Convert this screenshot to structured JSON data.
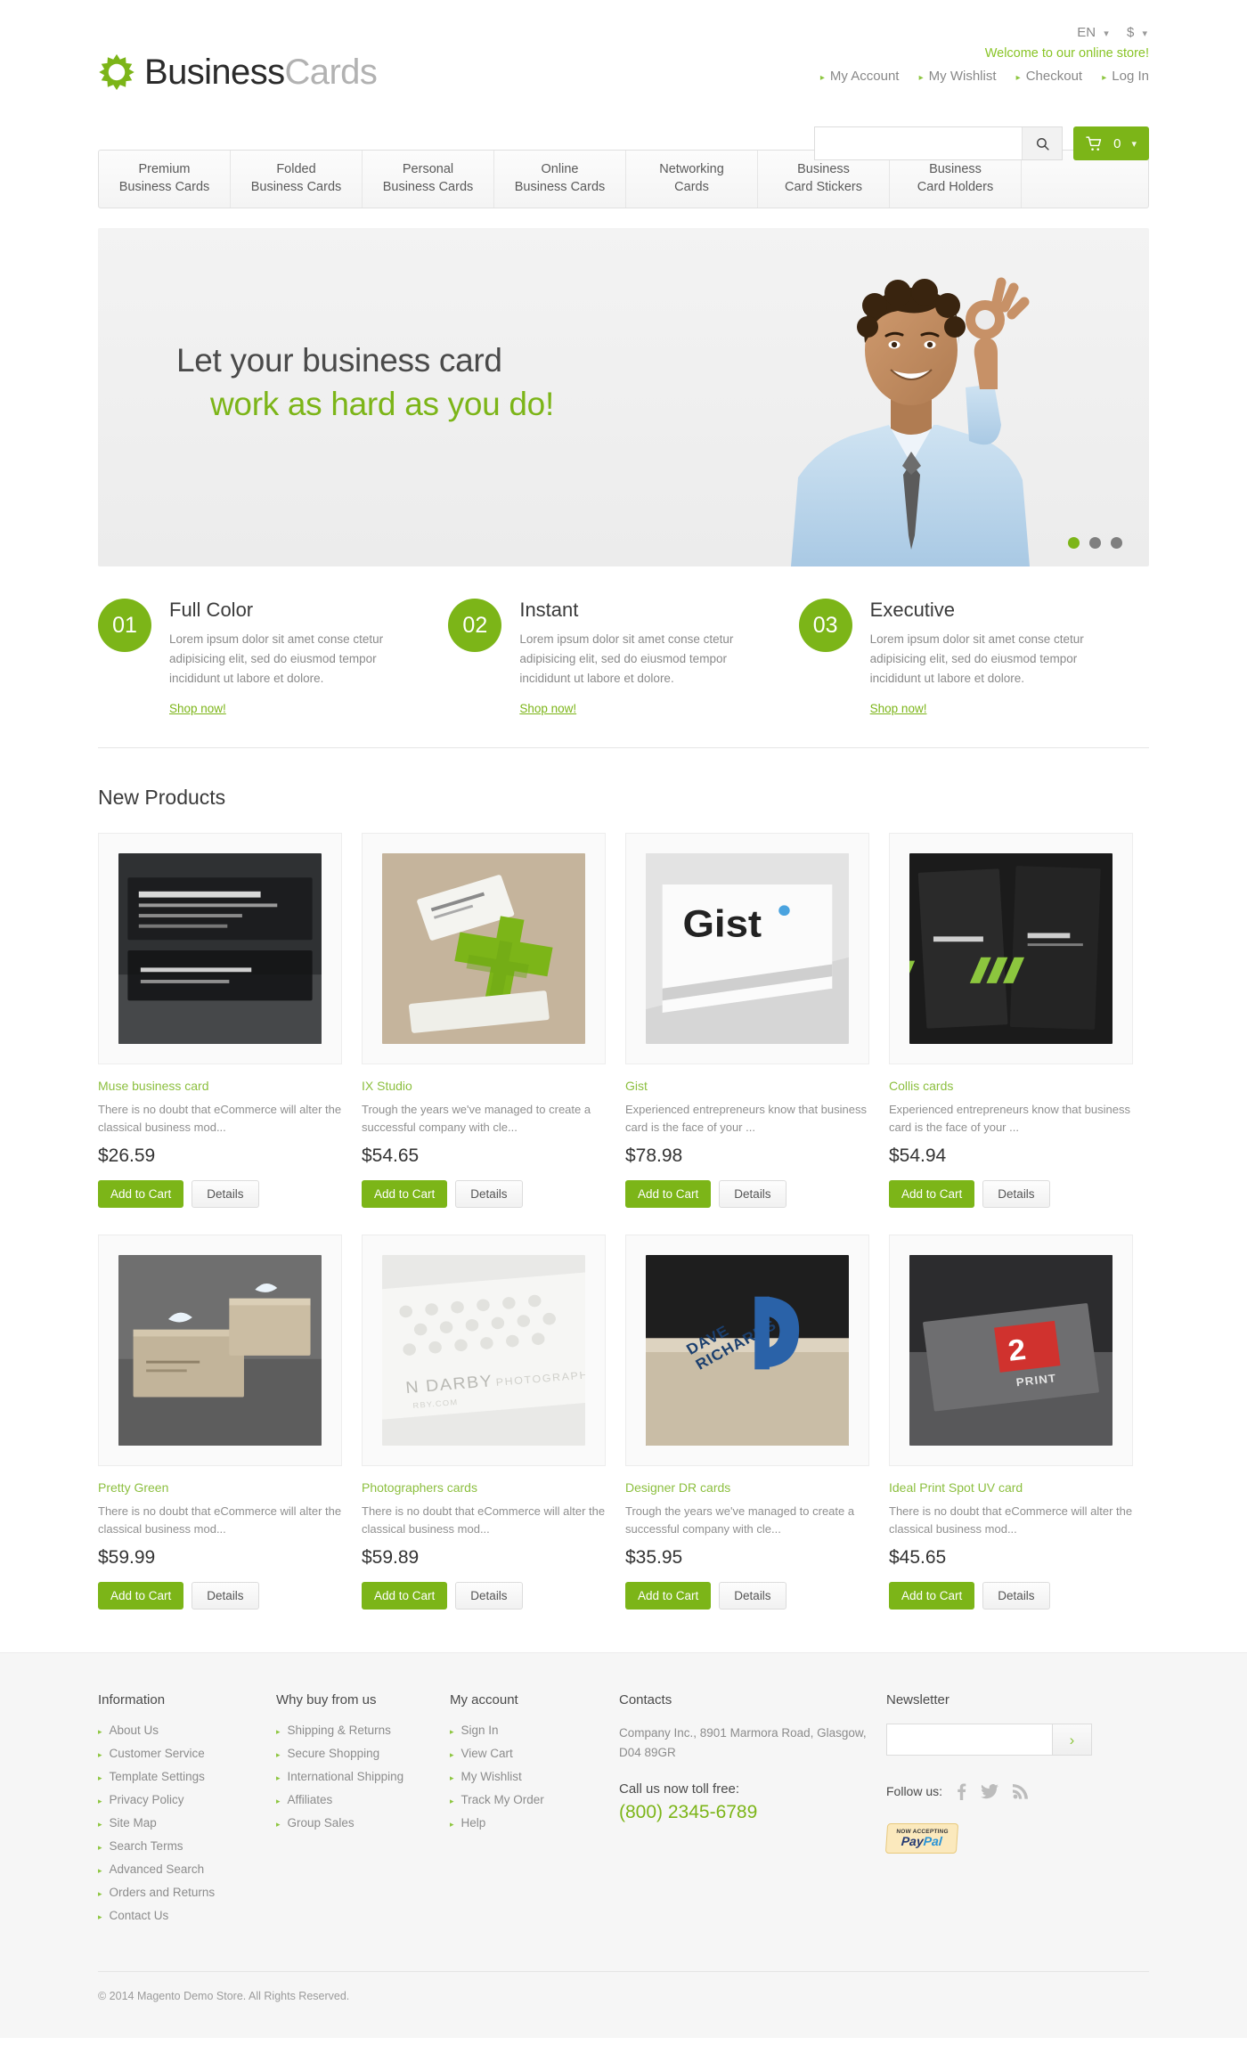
{
  "header": {
    "language": "EN",
    "currency": "$",
    "welcome": "Welcome to our online store!",
    "account_links": [
      "My Account",
      "My Wishlist",
      "Checkout",
      "Log In"
    ],
    "logo": {
      "part1": "Business",
      "part2": "Cards",
      "icon": "gear-sun-icon"
    },
    "search": {
      "value": "",
      "placeholder": ""
    },
    "cart": {
      "count": "0"
    }
  },
  "nav": {
    "items": [
      "Premium\nBusiness Cards",
      "Folded\nBusiness Cards",
      "Personal\nBusiness Cards",
      "Online\nBusiness Cards",
      "Networking\nCards",
      "Business\nCard Stickers",
      "Business\nCard Holders"
    ]
  },
  "hero": {
    "line1": "Let your business card",
    "line2": "work as hard as you do!",
    "dots": 3,
    "active_dot": 0
  },
  "features": [
    {
      "num": "01",
      "title": "Full Color",
      "desc": "Lorem ipsum dolor sit amet conse ctetur adipisicing elit, sed do eiusmod tempor incididunt ut labore et dolore.",
      "link": "Shop now!"
    },
    {
      "num": "02",
      "title": "Instant",
      "desc": "Lorem ipsum dolor sit amet conse ctetur adipisicing elit, sed do eiusmod tempor incididunt ut labore et dolore.",
      "link": "Shop now!"
    },
    {
      "num": "03",
      "title": "Executive",
      "desc": "Lorem ipsum dolor sit amet conse ctetur adipisicing elit, sed do eiusmod tempor incididunt ut labore et dolore.",
      "link": "Shop now!"
    }
  ],
  "new_products": {
    "title": "New Products",
    "add_to_cart_label": "Add to Cart",
    "details_label": "Details",
    "items": [
      {
        "name": "Muse business card",
        "desc": "There is no doubt that eCommerce will alter the classical business mod...",
        "price": "$26.59",
        "image": "dark-textured-card-photo"
      },
      {
        "name": "IX Studio",
        "desc": "Trough the years we've managed to create a successful company with cle...",
        "price": "$54.65",
        "image": "green-die-cut-cards-photo"
      },
      {
        "name": "Gist",
        "desc": "Experienced entrepreneurs know that business card is the face of your ...",
        "price": "$78.98",
        "image": "white-gist-card-photo"
      },
      {
        "name": "Collis cards",
        "desc": "Experienced entrepreneurs know that business card is the face of your ...",
        "price": "$54.94",
        "image": "black-green-stripe-cards-photo"
      },
      {
        "name": "Pretty Green",
        "desc": "There is no doubt that eCommerce will alter the classical business mod...",
        "price": "$59.99",
        "image": "kraft-stacked-cards-photo"
      },
      {
        "name": "Photographers cards",
        "desc": "There is no doubt that eCommerce will alter the classical business mod...",
        "price": "$59.89",
        "image": "white-embossed-card-photo"
      },
      {
        "name": "Designer DR cards",
        "desc": "Trough the years we've managed to create a successful company with cle...",
        "price": "$35.95",
        "image": "blue-letterpress-card-photo"
      },
      {
        "name": "Ideal Print Spot UV card",
        "desc": "There is no doubt that eCommerce will alter the classical business mod...",
        "price": "$45.65",
        "image": "red-spot-uv-card-photo"
      }
    ]
  },
  "footer": {
    "information": {
      "heading": "Information",
      "links": [
        "About Us",
        "Customer Service",
        "Template Settings",
        "Privacy Policy",
        "Site Map",
        "Search Terms",
        "Advanced Search",
        "Orders and Returns",
        "Contact Us"
      ]
    },
    "why_buy": {
      "heading": "Why buy from us",
      "links": [
        "Shipping & Returns",
        "Secure Shopping",
        "International Shipping",
        "Affiliates",
        "Group Sales"
      ]
    },
    "my_account": {
      "heading": "My account",
      "links": [
        "Sign In",
        "View Cart",
        "My Wishlist",
        "Track My Order",
        "Help"
      ]
    },
    "contacts": {
      "heading": "Contacts",
      "address": "Company Inc., 8901 Marmora Road, Glasgow, D04 89GR",
      "call_label": "Call us now toll free:",
      "phone": "(800) 2345-6789"
    },
    "newsletter": {
      "heading": "Newsletter",
      "value": "",
      "placeholder": "",
      "submit_icon": "chevron-right-icon"
    },
    "follow": {
      "label": "Follow us:",
      "icons": [
        "facebook-icon",
        "twitter-icon",
        "rss-icon"
      ]
    },
    "paypal": {
      "top": "NOW ACCEPTING",
      "pay": "Pay",
      "pal": "Pal"
    },
    "copyright": "© 2014 Magento Demo Store. All Rights Reserved."
  },
  "colors": {
    "brand_green": "#7cb518",
    "link_green": "#8cbf3f",
    "text_dark": "#3a3a3a"
  }
}
